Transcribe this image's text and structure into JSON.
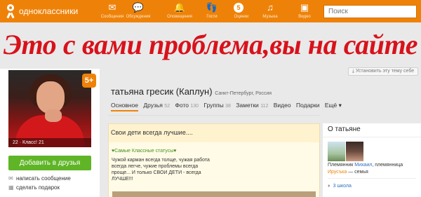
{
  "brand": {
    "name": "одноклассники"
  },
  "nav": [
    {
      "label": "Сообщения",
      "icon": "message-icon",
      "glyph": "✉"
    },
    {
      "label": "Обсуждения",
      "icon": "discussion-icon",
      "glyph": "💬"
    },
    {
      "label": "Оповещения",
      "icon": "bell-icon",
      "glyph": "🔔"
    },
    {
      "label": "Гости",
      "icon": "footprints-icon",
      "glyph": "👣"
    },
    {
      "label": "Оценки",
      "icon": "ratings-icon",
      "glyph": "5"
    },
    {
      "label": "Музыка",
      "icon": "music-icon",
      "glyph": "♫"
    },
    {
      "label": "Видео",
      "icon": "video-icon",
      "glyph": "▣"
    }
  ],
  "search": {
    "placeholder": "Поиск"
  },
  "banner": {
    "text": "Это с вами проблема,вы на сайте"
  },
  "theme_button": {
    "label": "Установить эту тему себе"
  },
  "profile": {
    "age_badge": "5+",
    "photo_stats": "22  ·  Класс! 21",
    "add_friend": "Добавить в друзья",
    "actions": [
      "написать сообщение",
      "сделать подарок"
    ],
    "name": "татьяна гресик  (Каплун)",
    "city": "Санкт-Петербург, Россия"
  },
  "tabs": [
    {
      "label": "Основное",
      "count": "",
      "active": true
    },
    {
      "label": "Друзья",
      "count": "52",
      "active": false
    },
    {
      "label": "Фото",
      "count": "130",
      "active": false
    },
    {
      "label": "Группы",
      "count": "38",
      "active": false
    },
    {
      "label": "Заметки",
      "count": "112",
      "active": false
    },
    {
      "label": "Видео",
      "count": "",
      "active": false
    },
    {
      "label": "Подарки",
      "count": "",
      "active": false
    },
    {
      "label": "Ещё ▾",
      "count": "",
      "active": false
    }
  ],
  "post": {
    "title": "Свои  дети всегда лучшие....",
    "tag": "♥Самые Классные статусы♥",
    "lines": [
      "Чужой карман всегда толще, чужая работа",
      "всегда легче, чужие проблемы всегда",
      "проще... И только СВОИ ДЕТИ - всегда",
      "ЛУЧШЕ!!!"
    ]
  },
  "about": {
    "title": "О татьяне",
    "relation1_prefix": "Племянник ",
    "relation1_link": "Михаил",
    "relation1_suffix": ", племянница",
    "relation2_link": "Ирусъка",
    "relation2_suffix": " — семья",
    "school": "3 школа"
  },
  "colors": {
    "brand": "#ee8208",
    "banner": "#d8121b",
    "button": "#5fb526"
  }
}
